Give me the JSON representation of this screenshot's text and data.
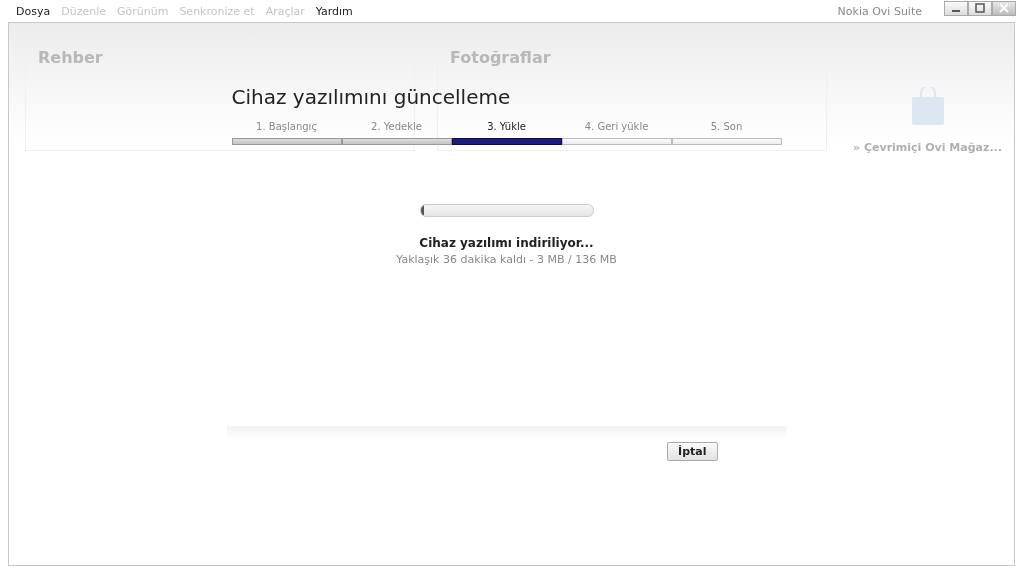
{
  "menu": [
    {
      "label": "Dosya",
      "disabled": false
    },
    {
      "label": "Düzenle",
      "disabled": true
    },
    {
      "label": "Görünüm",
      "disabled": true
    },
    {
      "label": "Senkronize et",
      "disabled": true
    },
    {
      "label": "Araçlar",
      "disabled": true
    },
    {
      "label": "Yardım",
      "disabled": false
    }
  ],
  "window": {
    "title": "Nokia Ovi Suite"
  },
  "background": {
    "panels": [
      "Rehber",
      "Fotoğraflar"
    ],
    "store_link": "» Çevrimiçi Ovi Mağaz..."
  },
  "dialog": {
    "title": "Cihaz yazılımını güncelleme",
    "steps": [
      {
        "label": "1. Başlangıç",
        "done": true,
        "selected": false
      },
      {
        "label": "2. Yedekle",
        "done": true,
        "selected": false
      },
      {
        "label": "3. Yükle",
        "done": false,
        "selected": true
      },
      {
        "label": "4. Geri yükle",
        "done": false,
        "selected": false
      },
      {
        "label": "5. Son",
        "done": false,
        "selected": false
      }
    ],
    "progress": {
      "level": 0.02
    },
    "status": "Cihaz yazılımı indiriliyor...",
    "detail": "Yaklaşık 36 dakika kaldı - 3 MB / 136 MB",
    "cancel": "İptal"
  }
}
